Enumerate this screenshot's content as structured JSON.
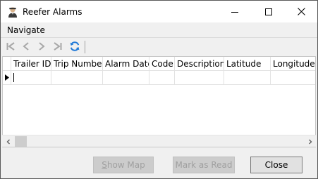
{
  "window": {
    "title": "Reefer Alarms",
    "controls": [
      "minimize",
      "maximize",
      "close"
    ]
  },
  "menu": {
    "items": [
      {
        "label": "Navigate"
      }
    ]
  },
  "toolbar": {
    "buttons": [
      {
        "name": "first-record",
        "icon": "skip-first-icon",
        "enabled": false
      },
      {
        "name": "previous-record",
        "icon": "chevron-left-icon",
        "enabled": false
      },
      {
        "name": "next-record",
        "icon": "chevron-right-icon",
        "enabled": false
      },
      {
        "name": "last-record",
        "icon": "skip-last-icon",
        "enabled": false
      },
      {
        "name": "refresh",
        "icon": "refresh-icon",
        "enabled": true
      }
    ]
  },
  "grid": {
    "columns": [
      "Trailer ID",
      "Trip Number",
      "Alarm Date",
      "Code",
      "Description",
      "Latitude",
      "Longitude"
    ],
    "rows": [
      {
        "current": true,
        "cells": [
          "",
          "",
          "",
          "",
          "",
          "",
          ""
        ]
      }
    ]
  },
  "buttons": {
    "show_map": {
      "label": "Show Map",
      "mnemonic": "S",
      "rest": "how Map",
      "enabled": false
    },
    "mark_read": {
      "label": "Mark as Read",
      "enabled": false
    },
    "close": {
      "label": "Close",
      "enabled": true
    }
  },
  "colors": {
    "refresh_icon": "#1e78d7",
    "disabled_icon": "#a8a8a8",
    "window_border": "#5a5a5a"
  }
}
